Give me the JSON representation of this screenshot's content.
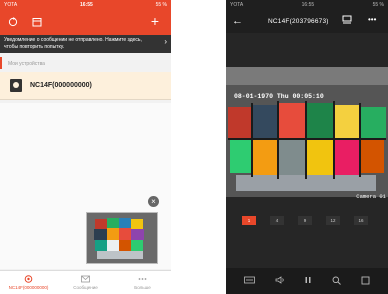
{
  "left": {
    "status": {
      "carrier": "YOTA",
      "time": "16:55",
      "battery": "55 %"
    },
    "notice": "Уведомление о сообщении не отправлено. Нажмите здесь, чтобы повторить попытку.",
    "section_label": "Мои устройства",
    "device_name": "NC14F(000000000)",
    "bottom_nav": [
      {
        "label": "NC14F(000000000)"
      },
      {
        "label": "Сообщение"
      },
      {
        "label": "Больше"
      }
    ],
    "accent_color": "#e8472a"
  },
  "right": {
    "status": {
      "carrier": "YOTA",
      "time": "16:55",
      "battery": "55 %"
    },
    "title": "NC14F(203796673)",
    "timestamp": "08-01-1970 Thu 00:05:10",
    "camera_label": "Camera 01",
    "split_options": [
      "1",
      "4",
      "9",
      "12",
      "16"
    ]
  }
}
